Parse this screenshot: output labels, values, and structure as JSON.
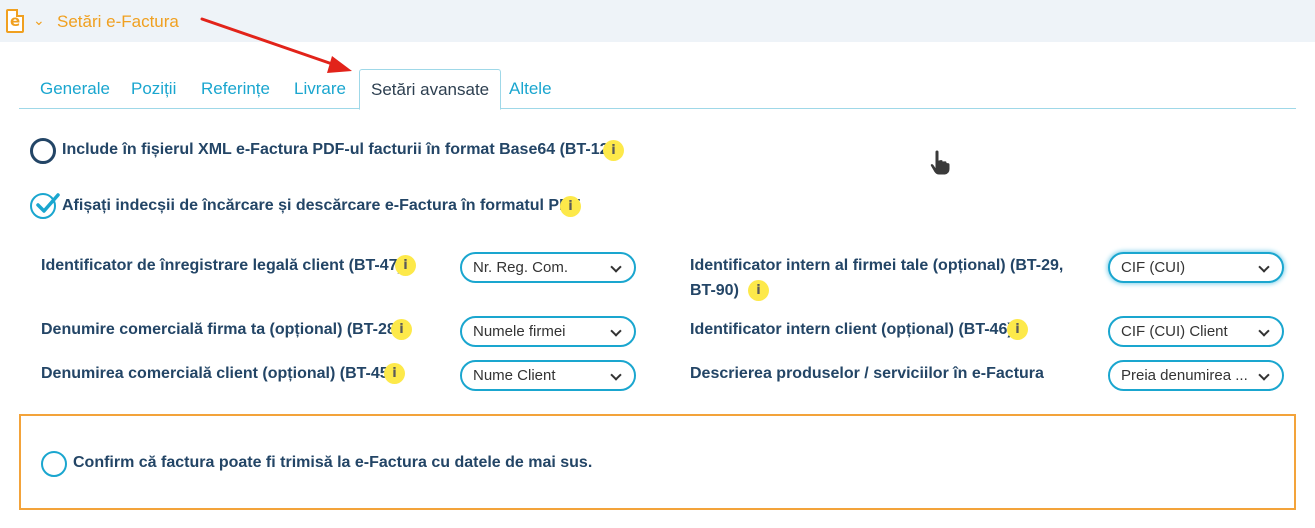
{
  "header": {
    "title": "Setări e-Factura",
    "icon": "e-document-icon"
  },
  "tabs": [
    {
      "label": "Generale",
      "active": false
    },
    {
      "label": "Poziții",
      "active": false
    },
    {
      "label": "Referințe",
      "active": false
    },
    {
      "label": "Livrare",
      "active": false
    },
    {
      "label": "Setări avansate",
      "active": true
    },
    {
      "label": "Altele",
      "active": false
    }
  ],
  "options": {
    "include_pdf": {
      "label": "Include în fișierul XML e-Factura PDF-ul facturii în format Base64 (BT-125)",
      "checked": false
    },
    "show_indexes": {
      "label": "Afișați indecșii de încărcare și descărcare e-Factura în formatul PDF",
      "checked": true
    }
  },
  "fields": {
    "bt47": {
      "label": "Identificator de înregistrare legală client (BT-47)",
      "value": "Nr. Reg. Com."
    },
    "bt28": {
      "label": "Denumire comercială firma ta (opțional) (BT-28)",
      "value": "Numele firmei"
    },
    "bt45": {
      "label": "Denumirea comercială client (opțional) (BT-45)",
      "value": "Nume Client"
    },
    "bt29": {
      "label_line1": "Identificator intern al firmei tale (opțional) (BT-29,",
      "label_line2": "BT-90)",
      "value": "CIF (CUI)"
    },
    "bt46": {
      "label": "Identificator intern client (opțional) (BT-46)",
      "value": "CIF (CUI) Client"
    },
    "desc": {
      "label": "Descrierea produselor / serviciilor în e-Factura",
      "value": "Preia denumirea ..."
    }
  },
  "info_glyph": "i",
  "confirm": {
    "label": "Confirm că factura poate fi trimisă la e-Factura cu datele de mai sus.",
    "checked": false
  },
  "colors": {
    "accent": "#1aa6cf",
    "header_orange": "#f0a020",
    "label_navy": "#234566",
    "info_yellow": "#fde94a",
    "confirm_border": "#f3a33a"
  }
}
